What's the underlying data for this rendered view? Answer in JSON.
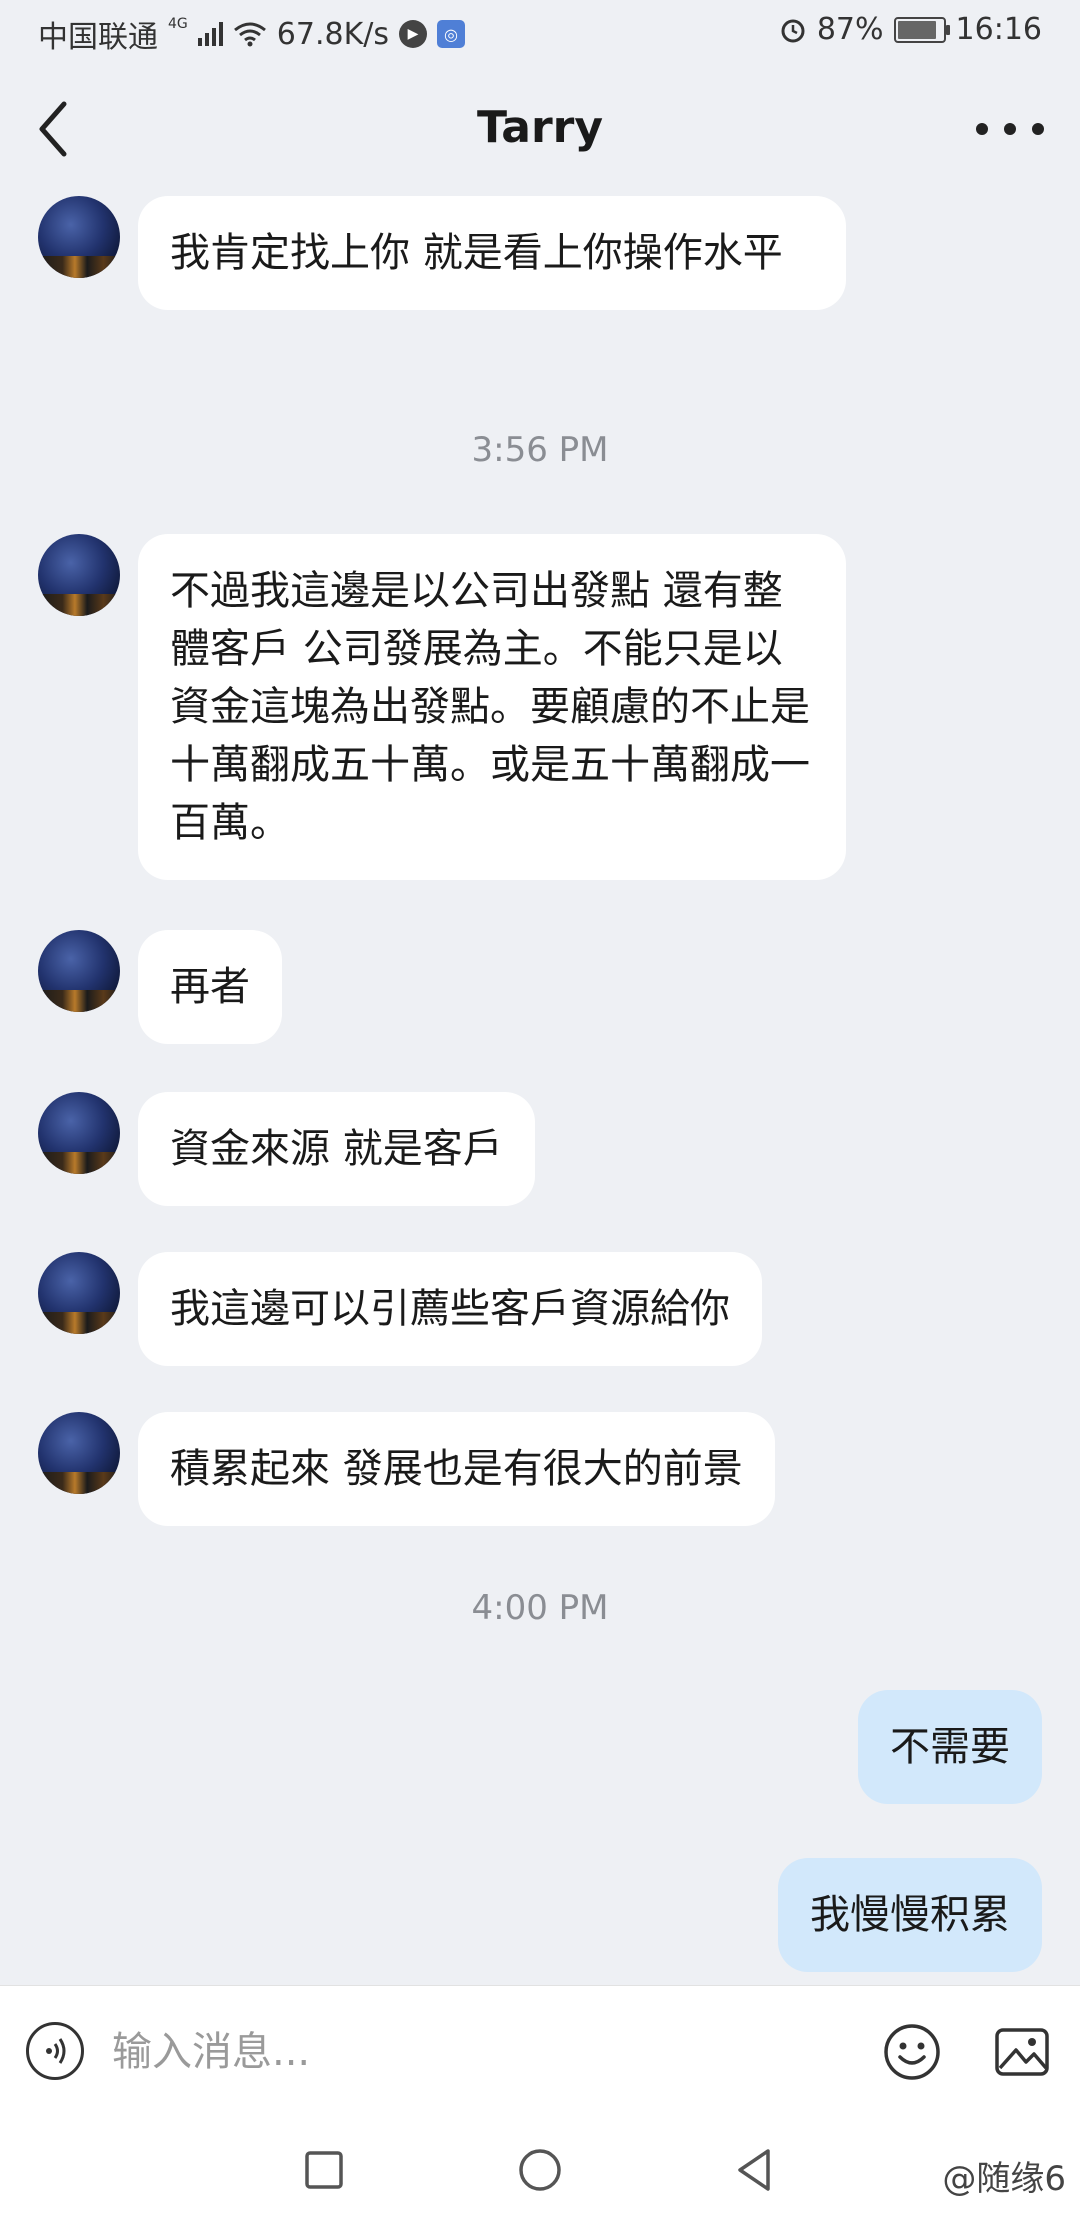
{
  "status_bar": {
    "carrier": "中国联通",
    "network": "4G",
    "speed": "67.8K/s",
    "battery_percent": "87%",
    "time": "16:16"
  },
  "header": {
    "title": "Tarry"
  },
  "messages": [
    {
      "from": "other",
      "text": "我肯定找上你 就是看上你操作水平"
    },
    {
      "timestamp": "3:56 PM"
    },
    {
      "from": "other",
      "text": "不過我這邊是以公司出發點 還有整體客戶 公司發展為主。不能只是以資金這塊為出發點。要顧慮的不止是十萬翻成五十萬。或是五十萬翻成一百萬。"
    },
    {
      "from": "other",
      "text": "再者"
    },
    {
      "from": "other",
      "text": "資金來源 就是客戶"
    },
    {
      "from": "other",
      "text": "我這邊可以引薦些客戶資源給你"
    },
    {
      "from": "other",
      "text": "積累起來 發展也是有很大的前景"
    },
    {
      "timestamp": "4:00 PM"
    },
    {
      "from": "me",
      "text": "不需要"
    },
    {
      "from": "me",
      "text": "我慢慢积累"
    }
  ],
  "input_bar": {
    "placeholder": "输入消息..."
  },
  "watermark": "@随缘6",
  "colors": {
    "background": "#eef0f4",
    "incoming_bubble": "#ffffff",
    "outgoing_bubble": "#d2e8fb",
    "timestamp": "#8a8d93"
  }
}
